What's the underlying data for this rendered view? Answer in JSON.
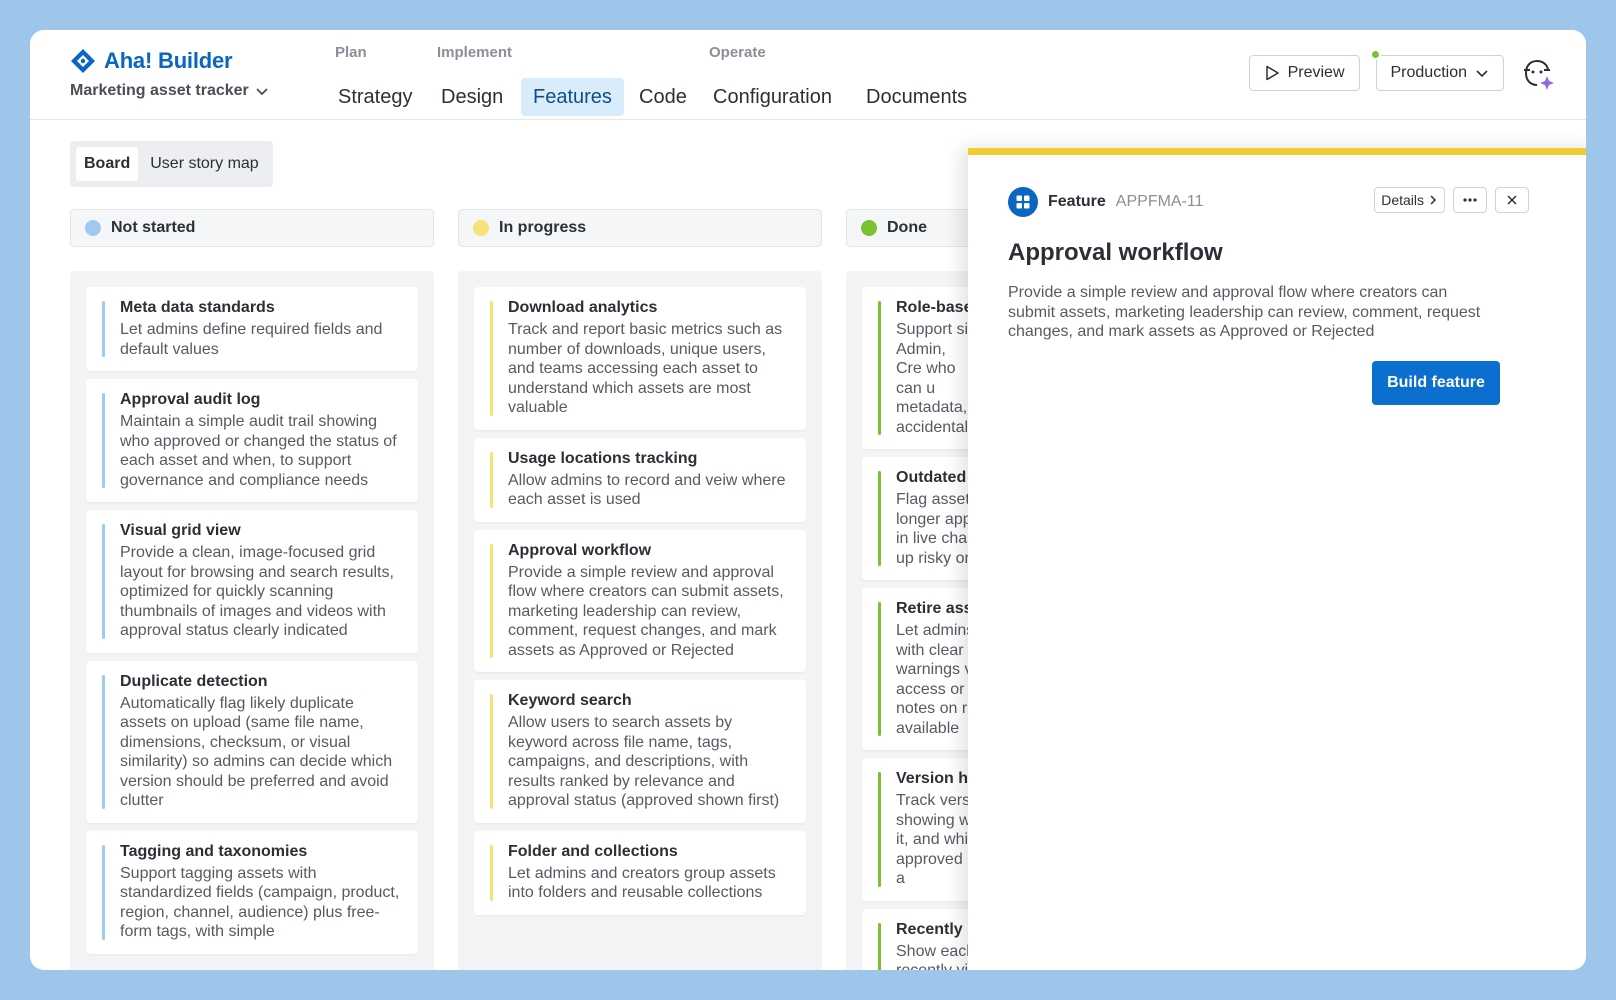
{
  "brand": {
    "name": "Aha! Builder",
    "project": "Marketing asset tracker"
  },
  "nav": {
    "groups": [
      "Plan",
      "Implement",
      "Operate"
    ],
    "tabs": [
      {
        "label": "Strategy"
      },
      {
        "label": "Design"
      },
      {
        "label": "Features",
        "active": true
      },
      {
        "label": "Code"
      },
      {
        "label": "Configuration"
      },
      {
        "label": "Documents"
      }
    ]
  },
  "header": {
    "preview_label": "Preview",
    "environment": "Production"
  },
  "subtabs": [
    {
      "label": "Board",
      "active": true
    },
    {
      "label": "User story map"
    }
  ],
  "columns": [
    {
      "name": "Not started",
      "color": "#9fcaf0",
      "cards": [
        {
          "title": "Meta data standards",
          "desc": "Let admins define required fields and default values"
        },
        {
          "title": "Approval audit log",
          "desc": "Maintain a simple audit trail showing who approved or changed the status of each asset and when, to support governance and compliance needs"
        },
        {
          "title": "Visual grid view",
          "desc": "Provide a clean, image-focused grid layout for browsing and search results, optimized for quickly scanning thumbnails of images and videos with approval status clearly indicated"
        },
        {
          "title": "Duplicate detection",
          "desc": "Automatically flag likely duplicate assets on upload (same file name, dimensions, checksum, or visual similarity) so admins can decide which version should be preferred and avoid clutter"
        },
        {
          "title": "Tagging and taxonomies",
          "desc": "Support tagging assets with standardized fields (campaign, product, region, channel, audience) plus free-form tags, with simple"
        }
      ]
    },
    {
      "name": "In progress",
      "color": "#f7e27a",
      "cards": [
        {
          "title": "Download analytics",
          "desc": "Track and report basic metrics such as number of downloads, unique users, and teams accessing each asset to understand which assets are most valuable"
        },
        {
          "title": "Usage locations tracking",
          "desc": "Allow admins to record and veiw where each asset is used"
        },
        {
          "title": "Approval workflow",
          "desc": "Provide a simple review and approval flow where creators can submit assets, marketing leadership can review, comment, request changes, and mark assets as Approved or Rejected"
        },
        {
          "title": "Keyword search",
          "desc": "Allow users to search assets by keyword across file name, tags, campaigns, and descriptions, with results ranked by relevance and approval status (approved shown first)"
        },
        {
          "title": "Folder and collections",
          "desc": "Let admins and creators group assets into folders and reusable collections"
        }
      ]
    },
    {
      "name": "Done",
      "color": "#7ac131",
      "cards": [
        {
          "title": "Role-base",
          "desc": "Support si Admin, Cre who can u metadata, accidental"
        },
        {
          "title": "Outdated",
          "desc": "Flag asset longer app in live char up risky or"
        },
        {
          "title": "Retire ass",
          "desc": "Let admins with clear warnings v access or notes on r available"
        },
        {
          "title": "Version hi",
          "desc": "Track vers showing w it, and whi approved a"
        },
        {
          "title": "Recently u",
          "desc": "Show each recently vi"
        }
      ]
    }
  ],
  "panel": {
    "type_label": "Feature",
    "id": "APPFMA-11",
    "details_label": "Details",
    "title": "Approval workflow",
    "description": "Provide a simple review and approval flow where creators can submit assets, marketing leadership can review, comment, request changes, and mark assets as Approved or Rejected",
    "build_label": "Build feature",
    "accent_color": "#f1cd32"
  },
  "colors": {
    "brand": "#0a66c2",
    "active_tab_bg": "#d9ecfb",
    "primary_button": "#0a6fce"
  },
  "icons": [
    "aha-logo-icon",
    "chevron-down-icon",
    "play-icon",
    "status-dot-icon",
    "ai-assistant-icon",
    "feature-grid-icon",
    "chevron-right-icon",
    "more-icon",
    "close-icon"
  ]
}
